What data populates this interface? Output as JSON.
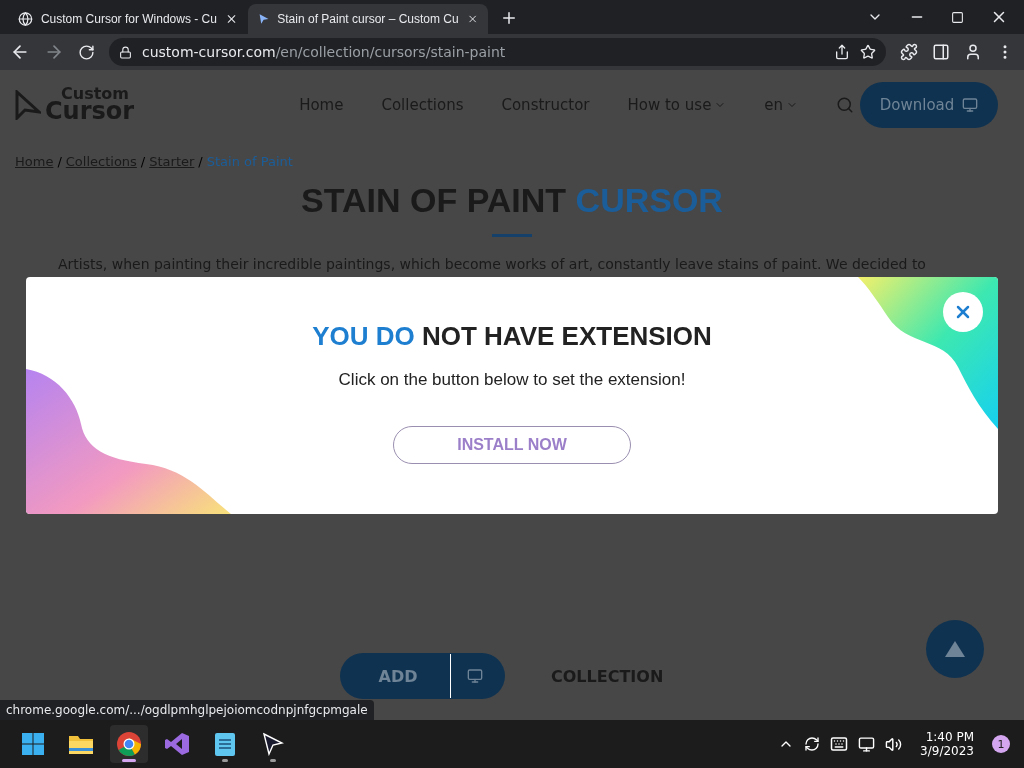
{
  "browser": {
    "tabs": [
      {
        "title": "Custom Cursor for Windows - Cu",
        "selected": false
      },
      {
        "title": "Stain of Paint cursor – Custom Cu",
        "selected": true
      }
    ],
    "url_host": "custom-cursor.com",
    "url_path": "/en/collection/cursors/stain-paint"
  },
  "site": {
    "logo_top": "Custom",
    "logo_bottom": "Cursor",
    "nav": [
      {
        "label": "Home",
        "dropdown": false
      },
      {
        "label": "Collections",
        "dropdown": false
      },
      {
        "label": "Constructor",
        "dropdown": false
      },
      {
        "label": "How to use",
        "dropdown": true
      },
      {
        "label": "en",
        "dropdown": true
      }
    ],
    "download": "Download",
    "breadcrumbs": [
      {
        "label": "Home",
        "current": false
      },
      {
        "separator": "/",
        "label": "Collections",
        "current": false
      },
      {
        "separator": "/",
        "label": "Starter",
        "current": false
      },
      {
        "separator": "/",
        "label": "Stain of Paint",
        "current": true
      }
    ],
    "title": "STAIN OF PAINT",
    "title_accent": "CURSOR",
    "description": "Artists, when painting their incredible paintings, which become works of art, constantly leave stains of paint. We decided to",
    "add_button": "ADD",
    "collection_button": "COLLECTION"
  },
  "modal": {
    "title_accent": "YOU DO",
    "title": "NOT HAVE EXTENSION",
    "message": "Click on the button below to set the extension!",
    "button": "INSTALL NOW"
  },
  "status_link": "chrome.google.com/.../ogdlpmhglpejoiomcodnpjnfgcpmgale",
  "taskbar": {
    "apps": [
      {
        "kind": "start",
        "running": false,
        "selected": false
      },
      {
        "kind": "folder",
        "running": false,
        "selected": false
      },
      {
        "kind": "chrome",
        "running": true,
        "selected": true
      },
      {
        "kind": "studio",
        "running": false,
        "selected": false
      },
      {
        "kind": "notepad",
        "running": true,
        "selected": false
      },
      {
        "kind": "cursor",
        "running": true,
        "selected": false
      }
    ],
    "time": "1:40 PM",
    "date": "3/9/2023",
    "notifications": "1"
  }
}
